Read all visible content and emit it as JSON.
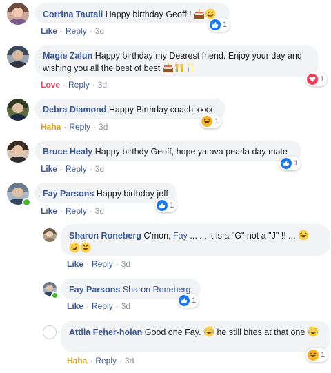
{
  "comments": [
    {
      "name": "Corrina Tautali",
      "text": "Happy birthday Geoff!!",
      "actions": {
        "first": "Like",
        "reply": "Reply",
        "time": "3d"
      },
      "reaction_count": "1"
    },
    {
      "name": "Magie Zalun",
      "text": "Happy birthday my Dearest friend. Enjoy your day and wishing you all the best of best",
      "actions": {
        "first": "Love",
        "reply": "Reply",
        "time": "3d"
      },
      "reaction_count": "1"
    },
    {
      "name": "Debra Diamond",
      "text": "Happy Birthday coach.xxxx",
      "actions": {
        "first": "Haha",
        "reply": "Reply",
        "time": "3d"
      },
      "reaction_count": "1"
    },
    {
      "name": "Bruce Healy",
      "text": "Happy birthdy Geoff, hope ya ava pearla day mate",
      "actions": {
        "first": "Like",
        "reply": "Reply",
        "time": "3d"
      },
      "reaction_count": "1"
    },
    {
      "name": "Fay Parsons",
      "text": "Happy birthday jeff",
      "actions": {
        "first": "Like",
        "reply": "Reply",
        "time": "3d"
      },
      "reaction_count": "1"
    }
  ],
  "replies": [
    {
      "name": "Sharon Roneberg",
      "pre": "C'mon,",
      "tag": "Fay",
      "text": "... ... it is a \"G\" not a \"J\" !! ...",
      "actions": {
        "first": "Like",
        "reply": "Reply",
        "time": "3d"
      }
    },
    {
      "name": "Fay Parsons",
      "tag": "Sharon Roneberg",
      "actions": {
        "first": "Like",
        "reply": "Reply",
        "time": "3d"
      },
      "reaction_count": "1"
    },
    {
      "name": "Attila Feher-holan",
      "text": "Good one Fay.",
      "text2": "he still bites at that one",
      "actions": {
        "first": "Haha",
        "reply": "Reply",
        "time": "3d"
      },
      "reaction_count": "1"
    }
  ],
  "icons": {
    "reactions": [
      "like-icon",
      "love-icon",
      "haha-icon"
    ],
    "emoji": [
      "cake-emoji",
      "smile-emoji",
      "cheers-emoji",
      "laughing-emoji",
      "rofl-emoji",
      "tears-of-joy-emoji"
    ]
  },
  "colors": {
    "name": "#385898",
    "bubble": "#f2f3f5",
    "like": "#1877f2",
    "love": "#f33e58",
    "haha": "#f7b125",
    "online": "#42b72a",
    "timestamp": "#90949c"
  }
}
